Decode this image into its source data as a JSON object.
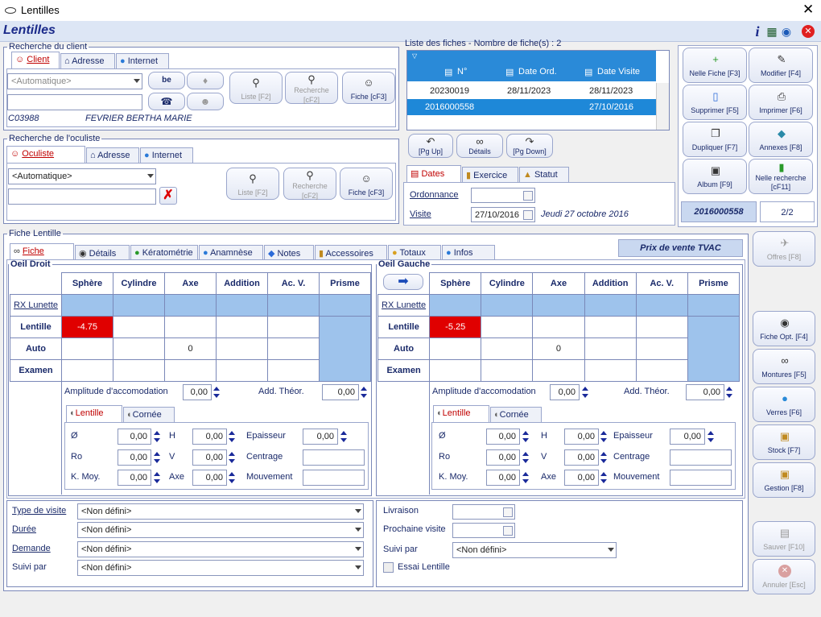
{
  "window": {
    "title": "Lentilles"
  },
  "header": {
    "title": "Lentilles"
  },
  "client_search": {
    "legend": "Recherche du client",
    "tabs": [
      "Client",
      "Adresse",
      "Internet"
    ],
    "combo_placeholder": "<Automatique>",
    "code": "C03988",
    "name": "FEVRIER BERTHA MARIE",
    "buttons": {
      "liste": "Liste [F2]",
      "recherche": "Recherche [cF2]",
      "fiche": "Fiche [cF3]"
    }
  },
  "oculist_search": {
    "legend": "Recherche de l'oculiste",
    "tabs": [
      "Oculiste",
      "Adresse",
      "Internet"
    ],
    "combo_value": "<Automatique>",
    "buttons": {
      "liste": "Liste [F2]",
      "recherche": "Recherche [cF2]",
      "fiche": "Fiche [cF3]"
    }
  },
  "fiches_list": {
    "legend": "Liste des fiches - Nombre de fiche(s) : 2",
    "columns": [
      "N°",
      "Date Ord.",
      "Date Visite"
    ],
    "rows": [
      {
        "num": "20230019",
        "date_ord": "28/11/2023",
        "date_visite": "28/11/2023"
      },
      {
        "num": "2016000558",
        "date_ord": "",
        "date_visite": "27/10/2016"
      }
    ],
    "nav": {
      "pgup": "[Pg Up]",
      "details": "Détails",
      "pgdown": "[Pg Down]"
    }
  },
  "dates": {
    "tabs": [
      "Dates",
      "Exercice",
      "Statut"
    ],
    "ordonnance_label": "Ordonnance",
    "visite_label": "Visite",
    "visite_value": "27/10/2016",
    "visite_text": "Jeudi 27 octobre 2016"
  },
  "actions": {
    "nouvelle_fiche": "Nelle Fiche [F3]",
    "modifier": "Modifier [F4]",
    "supprimer": "Supprimer [F5]",
    "imprimer": "Imprimer [F6]",
    "dupliquer": "Dupliquer [F7]",
    "annexes": "Annexes [F8]",
    "album": "Album [F9]",
    "nouvelle_recherche": "Nelle recherche [cF11]",
    "current_fiche": "2016000558",
    "page": "2/2"
  },
  "fiche_lentille": {
    "legend": "Fiche Lentille",
    "tabs": [
      "Fiche",
      "Détails",
      "Kératométrie",
      "Anamnèse",
      "Notes",
      "Accessoires",
      "Totaux",
      "Infos"
    ],
    "price_note": "Prix de vente TVAC",
    "columns": [
      "Sphère",
      "Cylindre",
      "Axe",
      "Addition",
      "Ac. V.",
      "Prisme"
    ],
    "row_labels": [
      "RX Lunette",
      "Lentille",
      "Auto",
      "Examen"
    ],
    "right_eye": {
      "legend": "Oeil Droit",
      "lentille_sphere": "-4.75",
      "auto_axe": "0",
      "amplitude": "0,00",
      "add_theor": "0,00",
      "diam": "0,00",
      "h": "0,00",
      "epaisseur": "0,00",
      "ro": "0,00",
      "v": "0,00",
      "kmoy": "0,00",
      "axe": "0,00"
    },
    "left_eye": {
      "legend": "Oeil Gauche",
      "lentille_sphere": "-5.25",
      "auto_axe": "0",
      "amplitude": "0,00",
      "add_theor": "0,00",
      "diam": "0,00",
      "h": "0,00",
      "epaisseur": "0,00",
      "ro": "0,00",
      "v": "0,00",
      "kmoy": "0,00",
      "axe": "0,00"
    },
    "labels": {
      "amplitude": "Amplitude d'accomodation",
      "add_theor": "Add. Théor.",
      "sub_tabs": [
        "Lentille",
        "Cornée"
      ],
      "diam": "Ø",
      "h": "H",
      "epaisseur": "Epaisseur",
      "ro": "Ro",
      "v": "V",
      "centrage": "Centrage",
      "kmoy": "K. Moy.",
      "axe": "Axe",
      "mouvement": "Mouvement"
    }
  },
  "visit": {
    "type_label": "Type de visite",
    "type_value": "<Non défini>",
    "duree_label": "Durée",
    "duree_value": "<Non défini>",
    "demande_label": "Demande",
    "demande_value": "<Non défini>",
    "suivi_label": "Suivi par",
    "suivi_value": "<Non défini>",
    "livraison_label": "Livraison",
    "prochaine_label": "Prochaine visite",
    "suivi2_label": "Suivi par",
    "suivi2_value": "<Non défini>",
    "essai_label": "Essai Lentille"
  },
  "side_buttons": {
    "offres": "Offres [F8]",
    "fiche_opt": "Fiche Opt. [F4]",
    "montures": "Montures [F5]",
    "verres": "Verres [F6]",
    "stock": "Stock [F7]",
    "gestion": "Gestion [F8]",
    "sauver": "Sauver [F10]",
    "annuler": "Annuler [Esc]"
  }
}
